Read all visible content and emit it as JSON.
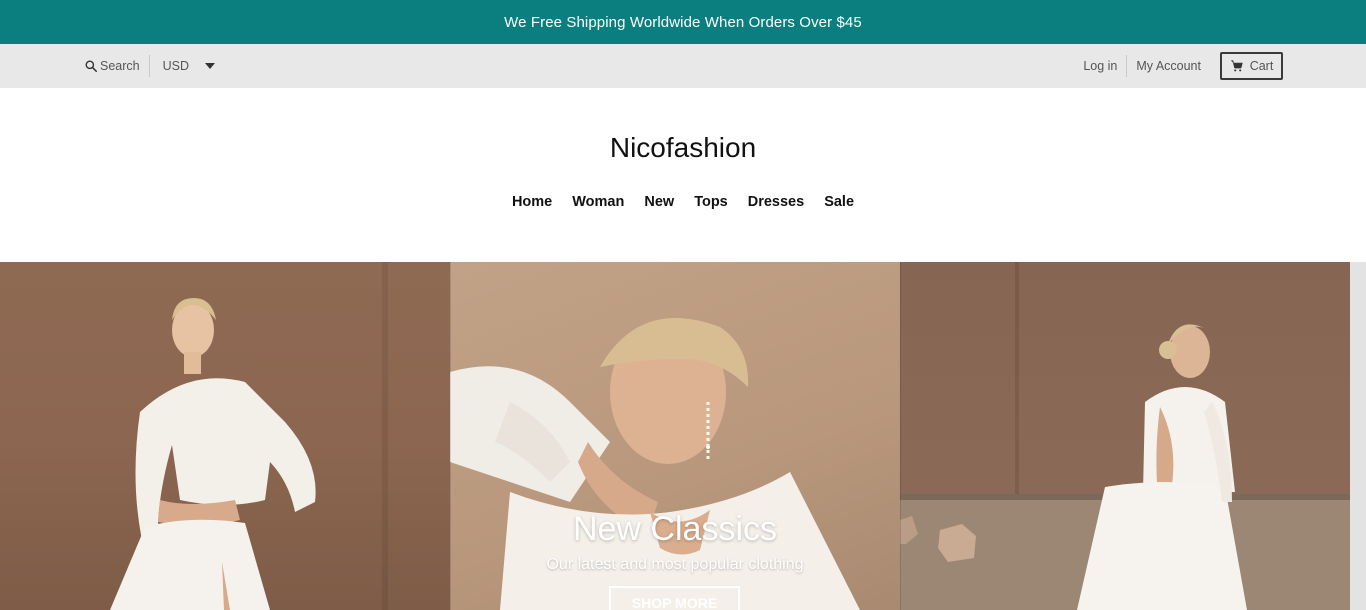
{
  "announcement": "We Free Shipping Worldwide When Orders Over $45",
  "utility": {
    "search_label": "Search",
    "currency": "USD",
    "login": "Log in",
    "account": "My Account",
    "cart": "Cart"
  },
  "brand": "Nicofashion",
  "nav": [
    "Home",
    "Woman",
    "New",
    "Tops",
    "Dresses",
    "Sale"
  ],
  "hero": {
    "title": "New Classics",
    "subtitle": "Our latest and most popular clothing",
    "button": "SHOP MORE"
  },
  "colors": {
    "announcement_bg": "#0b7f80",
    "utility_bg": "#e8e8e8"
  },
  "icons": {
    "search": "search-icon",
    "currency_caret": "caret-down-icon",
    "cart": "cart-icon"
  }
}
